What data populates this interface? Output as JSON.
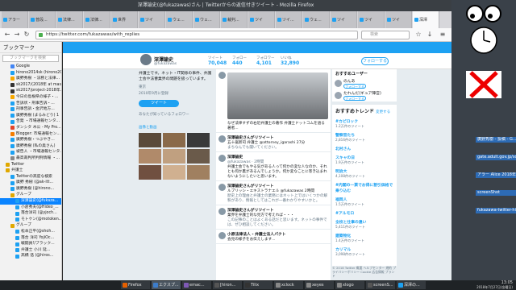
{
  "window": {
    "title": "深澤諭史(@fukazawas)さん | Twitterからの返信付きツイート - Mozilla Firefox"
  },
  "tabs": [
    {
      "label": "アラー"
    },
    {
      "label": "普段..."
    },
    {
      "label": "法律..."
    },
    {
      "label": "法律..."
    },
    {
      "label": "世界"
    },
    {
      "label": "ツイ"
    },
    {
      "label": "ウェ..."
    },
    {
      "label": "ウェ..."
    },
    {
      "label": "裁判..."
    },
    {
      "label": "ツイ"
    },
    {
      "label": "ツイ..."
    },
    {
      "label": "ウェ..."
    },
    {
      "label": "ツイ"
    },
    {
      "label": "ツイ"
    },
    {
      "label": "ツイ"
    },
    {
      "label": "深澤"
    }
  ],
  "navbar": {
    "url": "https://twitter.com/fukazawas/with_replies",
    "search_placeholder": "検索"
  },
  "sidebar": {
    "title": "ブックマーク",
    "search_placeholder": "ブックマークを検索",
    "items": [
      {
        "label": "Google",
        "color": "#4285f4",
        "indent": 2
      },
      {
        "label": "hirono2014sk (hirono20...",
        "color": "#1da1f2",
        "indent": 2
      },
      {
        "label": "廣野秀樹 ・法務と法律...",
        "color": "#f7a800",
        "indent": 2
      },
      {
        "label": "sk2017/(2018年 at mast...",
        "color": "#333333",
        "indent": 2
      },
      {
        "label": "sk2017/project-2018年...",
        "color": "#333333",
        "indent": 2
      },
      {
        "label": "今日の島根県の様子・...",
        "color": "#f7a800",
        "indent": 2
      },
      {
        "label": "告訴状・刑事告訴・...",
        "color": "#1da1f2",
        "indent": 2
      },
      {
        "label": "刑事告訴・金沢地方...",
        "color": "#1da1f2",
        "indent": 2
      },
      {
        "label": "廣野秀樹 (まるみどり) 1",
        "color": "#1da1f2",
        "indent": 2
      },
      {
        "label": "告発 ・市場通報センタ...",
        "color": "#1da1f2",
        "indent": 2
      },
      {
        "label": "ダンシタ 木公 - My Pro...",
        "color": "#e24329",
        "indent": 2
      },
      {
        "label": "Blogger: 市場通報セン...",
        "color": "#f57d00",
        "indent": 2
      },
      {
        "label": "廣野秀樹・つぶやき...",
        "color": "#1da1f2",
        "indent": 2
      },
      {
        "label": "廣野秀樹 (私の奥さん)",
        "color": "#1da1f2",
        "indent": 2
      },
      {
        "label": "被告人 ・市場通報センタ...",
        "color": "#1da1f2",
        "indent": 2
      },
      {
        "label": "最高裁判所判例情報 ・...",
        "color": "#888888",
        "indent": 2
      },
      {
        "label": "Twitter",
        "color": "#e0a800",
        "indent": 1
      },
      {
        "label": "弁護士",
        "color": "#e0a800",
        "indent": 1
      },
      {
        "label": "Twitterの高度な検索",
        "color": "#1da1f2",
        "indent": 2
      },
      {
        "label": "廣野 秀樹 (@ak-itt...",
        "color": "#1da1f2",
        "indent": 2
      },
      {
        "label": "廣野秀樹 (@hirono...",
        "color": "#1da1f2",
        "indent": 2
      },
      {
        "label": "グループ",
        "color": "#e0a800",
        "indent": 2
      },
      {
        "label": "深澤諭史(@fukaza...",
        "color": "#1da1f2",
        "indent": 3,
        "selected": true
      },
      {
        "label": "小倉秀夫(@Hideo_...",
        "color": "#1da1f2",
        "indent": 3
      },
      {
        "label": "落合洋司 (@yjoch...",
        "color": "#1da1f2",
        "indent": 3
      },
      {
        "label": "モトケン(@motoken...",
        "color": "#1da1f2",
        "indent": 3
      },
      {
        "label": "グループ",
        "color": "#e0a800",
        "indent": 2
      },
      {
        "label": "松本正平(@shoh...",
        "color": "#1da1f2",
        "indent": 3
      },
      {
        "label": "落合 洋司 YojiOc...",
        "color": "#1da1f2",
        "indent": 3
      },
      {
        "label": "戦闘員!/ブラック...",
        "color": "#1da1f2",
        "indent": 3
      },
      {
        "label": "弁護士 小川 延...",
        "color": "#1da1f2",
        "indent": 3
      },
      {
        "label": "高橋 浩 (@hiros...",
        "color": "#1da1f2",
        "indent": 3
      }
    ]
  },
  "profile": {
    "name": "深澤諭史",
    "handle": "@fukazawas",
    "bio": "弁護士です。ネット・IT関係の事件、弁護士会や法曹業界の問題を扱っています。",
    "location": "東京",
    "joined": "2010年9月に登録",
    "tweet_button": "ツイート",
    "followers_you_know": "あなたが知っているフォロワー",
    "media_label": "画像と動画",
    "stats": [
      {
        "label": "ツイート",
        "value": "70,048"
      },
      {
        "label": "フォロー",
        "value": "440"
      },
      {
        "label": "フォロワー",
        "value": "4,101"
      },
      {
        "label": "いいね",
        "value": "32,890"
      }
    ],
    "follow_button": "フォローする"
  },
  "tweets": [
    {
      "name": "",
      "meta": "",
      "text": "なぜ法律すずの右近弁護士の著作 弁護士ドットコムを語る著者...",
      "has_image": true
    },
    {
      "name": "深澤諭史さんがリツイート",
      "meta": "",
      "text": "五十嵐新司 弁護士 @attorney_igarashi 27分",
      "sub": "まちなんでも聞いてください。"
    },
    {
      "name": "深澤諭史",
      "meta": "@fukazawas · 2時間",
      "text": "弁護士会でもやる気がある人って何かの変な人なのか、それとも何か裏があるんでしょうか。何か変なことに巻き込まれないようにしたいと思います。"
    },
    {
      "name": "深澤諭史さんがリツイート",
      "meta": "",
      "text": "ルブリッシ・エキストラナエル @fukazawas 2時間",
      "sub": "歴史上の理由と弁護士の業務にはネット上ではいくつかの解釈があり、情報としてはこれが一番わかりやすいかと。"
    },
    {
      "name": "深澤諭史さんがリツイート",
      "meta": "",
      "text": "業界を弁護士的な見方で考えれば・・・",
      "sub": "この記事のことはよくある話だと思います。ネットの事件では、ぜひ相談してください。"
    },
    {
      "name": "小原法律法人 - 弁護士法人パクト",
      "meta": "",
      "text": "会見の様子をお伝えします..."
    }
  ],
  "who_to_follow": {
    "title": "おすすめユーザー",
    "follow_label": "フォローする",
    "users": [
      {
        "name": "のんあ"
      },
      {
        "name": "たれんだ(ギュア陣営)"
      }
    ]
  },
  "trends": {
    "title": "おすすめトレンド",
    "change": "変更する",
    "items": [
      {
        "tag": "#カピロック",
        "count": "1.2万件のツイート"
      },
      {
        "tag": "警察官たち",
        "count": "2,816件のツイート"
      },
      {
        "tag": "北村さん",
        "count": ""
      },
      {
        "tag": "スキャの日",
        "count": "1.9万件のツイート"
      },
      {
        "tag": "明治大",
        "count": "4,108件のツイート"
      },
      {
        "tag": "#内閣の一票でお得に割引価格で乗り込む",
        "count": ""
      },
      {
        "tag": "福岡人",
        "count": "1.5万件のツイート"
      },
      {
        "tag": "#アルモロ",
        "count": ""
      },
      {
        "tag": "全校と仕事の違い",
        "count": "5,411件のツイート"
      },
      {
        "tag": "建築物化",
        "count": "1.4万件のツイート"
      },
      {
        "tag": "カリマル",
        "count": "3,098件のツイート"
      }
    ]
  },
  "footer": {
    "text": "© 2018 Twitter 概要 ヘルプセンター 規約 プライバシーポリシー Cookie 広告情報 ブランド"
  },
  "desktop_windows": [
    {
      "label": "廣野秀樹 - 投稿 - G..."
    },
    {
      "label": "gate.adult.gov.jp/sd..."
    },
    {
      "label": "アラー Alice 2018年"
    },
    {
      "label": "screenShot"
    },
    {
      "label": "fukazawa-twitter-hi..."
    }
  ],
  "taskbar": {
    "tasks": [
      {
        "label": "Firefox",
        "color": "#e66000"
      },
      {
        "label": "エクスプ...",
        "color": "#3d7dca",
        "active": true
      },
      {
        "label": "emac...",
        "color": "#7f5ab6"
      },
      {
        "label": "[hiron...",
        "color": "#555555"
      },
      {
        "label": "Tilix",
        "color": "#333333"
      },
      {
        "label": "xclock",
        "color": "#888888"
      },
      {
        "label": "xeyes",
        "color": "#888888"
      },
      {
        "label": "xlogo",
        "color": "#888888"
      },
      {
        "label": "screenS...",
        "color": "#555555"
      },
      {
        "label": "深澤の...",
        "color": "#1da1f2"
      }
    ],
    "clock": "13:05",
    "date": "2018年7月27日(金曜日)"
  }
}
